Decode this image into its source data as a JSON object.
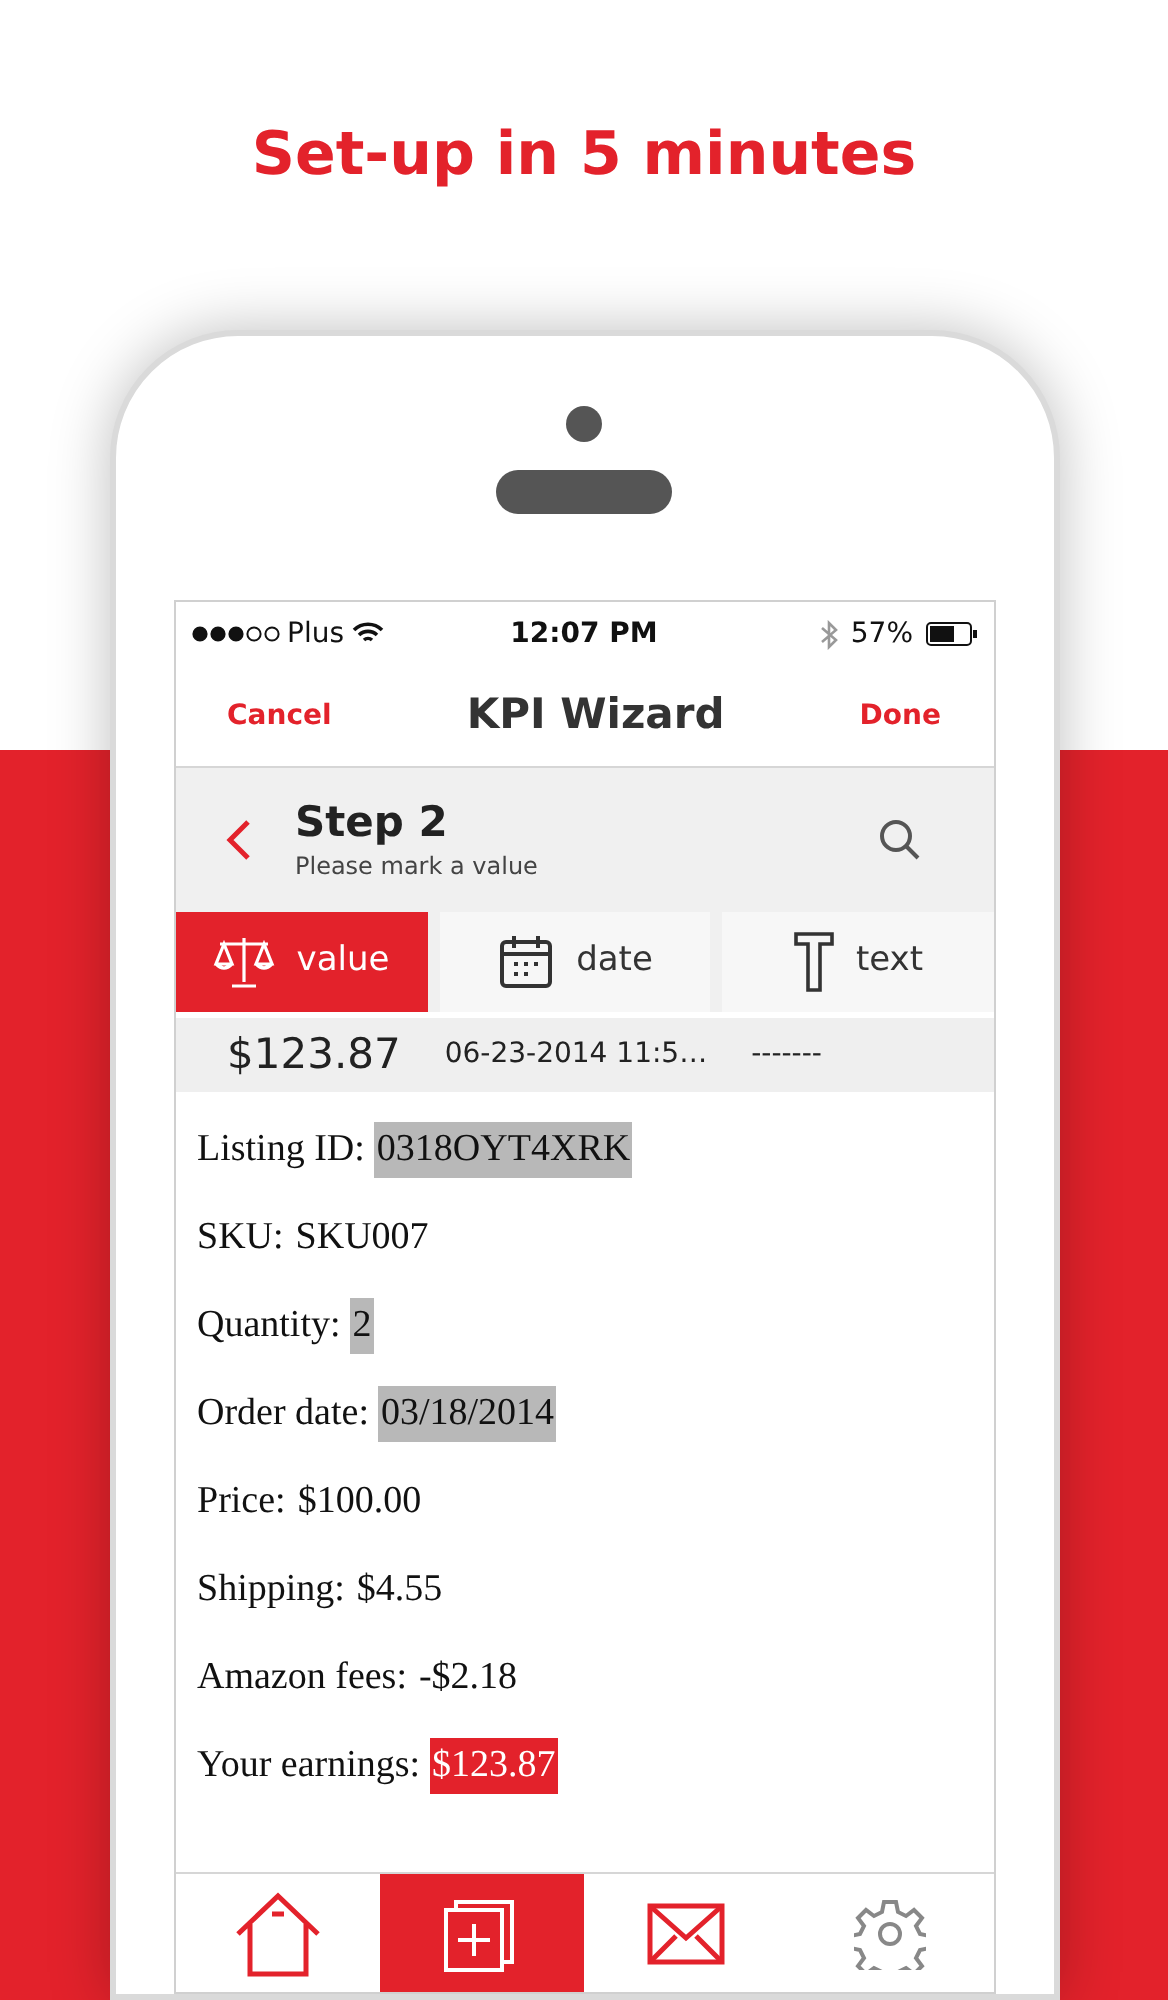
{
  "headline": "Set-up in 5 minutes",
  "status_bar": {
    "carrier": "Plus",
    "time": "12:07 PM",
    "battery": "57%"
  },
  "nav": {
    "cancel": "Cancel",
    "title": "KPI Wizard",
    "done": "Done"
  },
  "step": {
    "title": "Step 2",
    "subtitle": "Please mark a value"
  },
  "type_tabs": [
    {
      "kind": "value",
      "label": "value",
      "selected": true
    },
    {
      "kind": "date",
      "label": "date",
      "selected": false
    },
    {
      "kind": "text",
      "label": "text",
      "selected": false
    }
  ],
  "values_row": [
    "$123.87",
    "06-23-2014 11:5…",
    "-------"
  ],
  "fields": [
    {
      "label": "Listing ID:",
      "value": "0318OYT4XRK",
      "highlighted": true,
      "selected": false
    },
    {
      "label": "SKU:",
      "value": "SKU007",
      "highlighted": false,
      "selected": false
    },
    {
      "label": "Quantity:",
      "value": "2",
      "highlighted": true,
      "selected": false
    },
    {
      "label": "Order date:",
      "value": "03/18/2014",
      "highlighted": true,
      "selected": false
    },
    {
      "label": "Price:",
      "value": "$100.00",
      "highlighted": false,
      "selected": false
    },
    {
      "label": "Shipping:",
      "value": "$4.55",
      "highlighted": false,
      "selected": false
    },
    {
      "label": "Amazon fees:",
      "value": "-$2.18",
      "highlighted": false,
      "selected": false
    },
    {
      "label": "Your earnings:",
      "value": "$123.87",
      "highlighted": true,
      "selected": true
    }
  ],
  "bottom_tabs": [
    {
      "kind": "home",
      "selected": false
    },
    {
      "kind": "add",
      "selected": true
    },
    {
      "kind": "mail",
      "selected": false
    },
    {
      "kind": "settings",
      "selected": false
    }
  ]
}
